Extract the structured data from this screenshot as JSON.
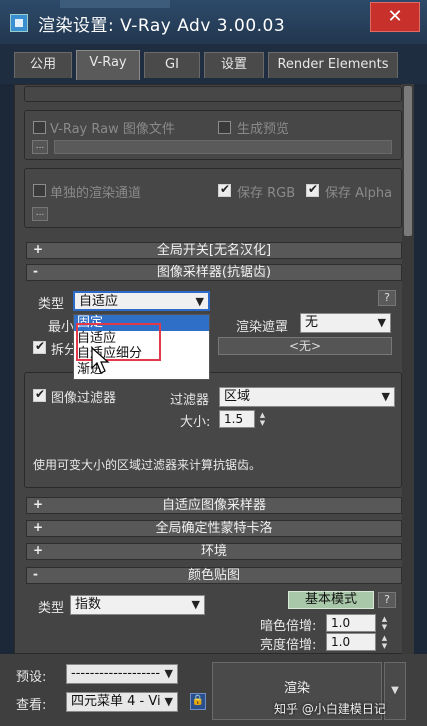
{
  "window": {
    "title": "渲染设置: V-Ray Adv 3.00.03",
    "close_glyph": "✕"
  },
  "tabs": [
    {
      "label": "公用",
      "active": false
    },
    {
      "label": "V-Ray",
      "active": true
    },
    {
      "label": "GI",
      "active": false
    },
    {
      "label": "设置",
      "active": false
    },
    {
      "label": "Render Elements",
      "active": false
    }
  ],
  "raw_section": {
    "vray_raw_label": "V-Ray Raw 图像文件",
    "preview_label": "生成预览",
    "browse_label": "..."
  },
  "separate_section": {
    "separate_channel_label": "单独的渲染通道",
    "save_rgb_label": "保存 RGB",
    "save_alpha_label": "保存 Alpha",
    "browse_label": "..."
  },
  "rollouts": {
    "global_switches": {
      "sign": "+",
      "label": "全局开关[无名汉化]"
    },
    "image_sampler": {
      "sign": "-",
      "label": "图像采样器(抗锯齿)"
    },
    "adaptive_sampler": {
      "sign": "+",
      "label": "自适应图像采样器"
    },
    "global_dmc": {
      "sign": "+",
      "label": "全局确定性蒙特卡洛"
    },
    "environment": {
      "sign": "+",
      "label": "环境"
    },
    "color_mapping": {
      "sign": "-",
      "label": "颜色贴图"
    }
  },
  "image_sampler": {
    "type_label": "类型",
    "type_value": "自适应",
    "min_label": "最小",
    "split_label": "拆分",
    "render_mask_label": "渲染遮罩",
    "render_mask_value": "无",
    "mask_button_label": "<无>",
    "help_label": "?",
    "dropdown_options": [
      {
        "label": "固定",
        "selected": true
      },
      {
        "label": "自适应",
        "selected": false
      },
      {
        "label": "自适应细分",
        "selected": false
      },
      {
        "label": "渐进",
        "selected": false
      }
    ]
  },
  "image_filter": {
    "enable_label": "图像过滤器",
    "enabled": true,
    "filter_label": "过滤器",
    "filter_value": "区域",
    "size_label": "大小:",
    "size_value": "1.5",
    "description": "使用可变大小的区域过滤器来计算抗锯齿。"
  },
  "color_mapping": {
    "type_label": "类型",
    "type_value": "指数",
    "mode_button_label": "基本模式",
    "help_label": "?",
    "dark_multiplier_label": "暗色倍增:",
    "dark_multiplier_value": "1.0",
    "bright_multiplier_label": "亮度倍增:",
    "bright_multiplier_value": "1.0"
  },
  "bottom": {
    "preset_label": "预设:",
    "preset_value": "-------------------",
    "view_label": "查看:",
    "view_value": "四元菜单 4 - Vi",
    "render_label": "渲染",
    "watermark": "知乎 @小白建模日记"
  },
  "colors": {
    "titlebar": "#2d4a6a",
    "close_button": "#c8312b",
    "panel": "#444444",
    "dropdown_selection": "#2f6fc8",
    "annotation_box": "#e23a4a"
  }
}
